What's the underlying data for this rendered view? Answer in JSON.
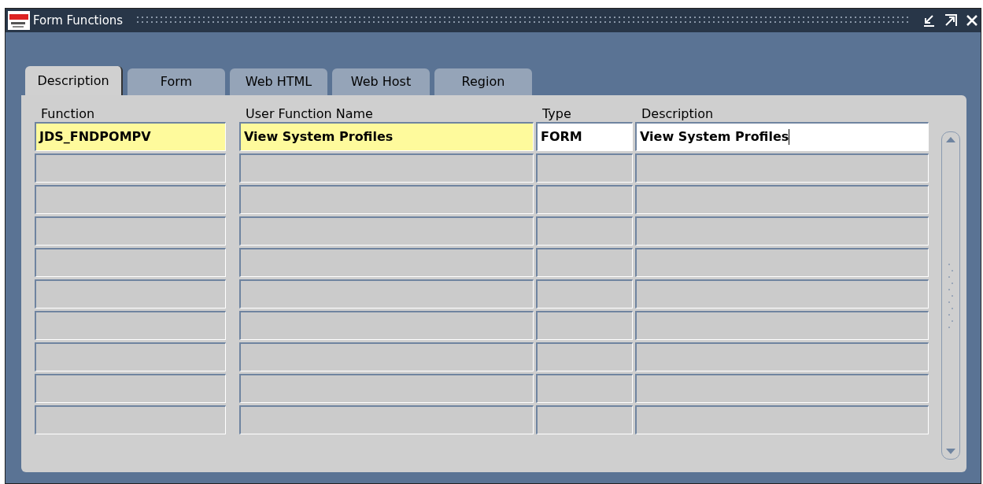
{
  "window": {
    "title": "Form Functions"
  },
  "tabs": [
    {
      "label": "Description",
      "selected": true
    },
    {
      "label": "Form",
      "selected": false
    },
    {
      "label": "Web HTML",
      "selected": false
    },
    {
      "label": "Web Host",
      "selected": false
    },
    {
      "label": "Region",
      "selected": false
    }
  ],
  "table": {
    "columns": [
      "Function",
      "User Function Name",
      "Type",
      "Description"
    ],
    "rows": [
      {
        "selected": true,
        "cells": [
          {
            "value": "JDS_FNDPOMPV",
            "required": true,
            "focused": false
          },
          {
            "value": "View System Profiles",
            "required": true,
            "focused": false
          },
          {
            "value": "FORM",
            "required": false,
            "focused": false
          },
          {
            "value": "View System Profiles",
            "required": false,
            "focused": true
          }
        ]
      },
      {
        "selected": false
      },
      {
        "selected": false
      },
      {
        "selected": false
      },
      {
        "selected": false
      },
      {
        "selected": false
      },
      {
        "selected": false
      },
      {
        "selected": false
      },
      {
        "selected": false
      },
      {
        "selected": false
      }
    ]
  }
}
